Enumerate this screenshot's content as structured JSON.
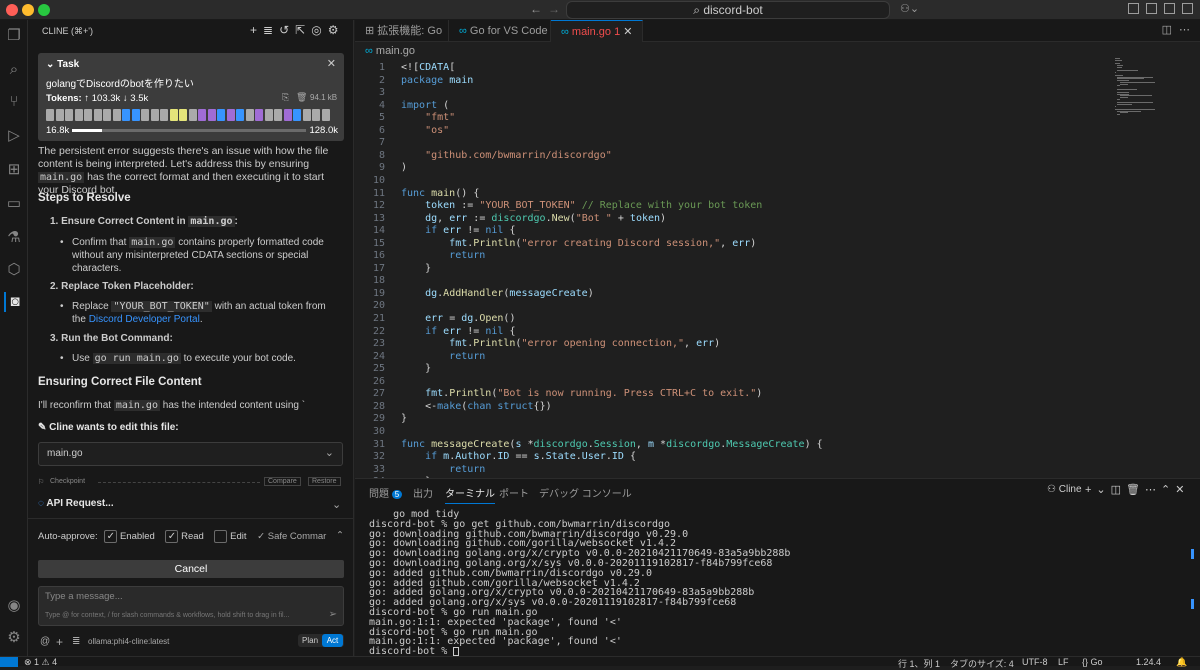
{
  "titlebar": {
    "search": "discord-bot"
  },
  "sidebar": {
    "header": "CLINE (⌘+')",
    "task": {
      "label": "Task",
      "text": "golangでDiscordのbotを作りたい",
      "tokens_label": "Tokens:",
      "tokens_up": "↑ 103.3k",
      "tokens_down": "↓ 3.5k",
      "size": "94.1 kB",
      "ctx_used": "16.8k",
      "ctx_max": "128.0k",
      "ctx_fraction": 0.13
    },
    "intro": "The persistent error suggests there's an issue with how the file content is being interpreted. Let's address this by ensuring",
    "intro_code": "main.go",
    "intro2": "has the correct format and then executing it to start your Discord bot.",
    "steps_heading": "Steps to Resolve",
    "step1_title": "1. Ensure Correct Content in",
    "step1_code": "main.go",
    "step1_colon": ":",
    "step1_a": "Confirm that",
    "step1_b": "main.go",
    "step1_c": "contains properly formatted code without any misinterpreted CDATA sections or special characters.",
    "step2_title": "2. Replace Token Placeholder:",
    "step2_a": "Replace",
    "step2_b": "\"YOUR_BOT_TOKEN\"",
    "step2_c": "with an actual token from the",
    "step2_link": "Discord Developer Portal",
    "step3_title": "3. Run the Bot Command:",
    "step3_a": "Use",
    "step3_b": "go run main.go",
    "step3_c": "to execute your bot code.",
    "ensuring_heading": "Ensuring Correct File Content",
    "reconfirm_a": "I'll reconfirm that",
    "reconfirm_b": "main.go",
    "reconfirm_c": "has the intended content using `",
    "edit_label": "Cline wants to edit this file:",
    "file": "main.go",
    "checkpoint": "Checkpoint",
    "compare": "Compare",
    "restore": "Restore",
    "api": "API Request...",
    "auto_approve": "Auto-approve:",
    "enabled": "Enabled",
    "read": "Read",
    "edit": "Edit",
    "safe": "Safe Commar",
    "cancel": "Cancel",
    "msg_placeholder": "Type a message...",
    "msg_hint": "Type @ for context, / for slash commands & workflows, hold shift to drag in fil...",
    "model": "ollama:phi4-cline:latest",
    "plan": "Plan",
    "act": "Act"
  },
  "editor": {
    "tabs": [
      {
        "label": "拡張機能: Go"
      },
      {
        "label": "Go for VS Code"
      },
      {
        "label": "main.go",
        "badge": "1"
      }
    ],
    "breadcrumb": "main.go"
  },
  "panel": {
    "tabs": [
      "問題",
      "出力",
      "ターミナル",
      "ポート",
      "デバッグ コンソール"
    ],
    "problems_count": "5",
    "terminal_name": "Cline"
  },
  "status": {
    "left": "⊗ 1 ⚠ 4",
    "pos": "行 1、列 1",
    "tab": "タブのサイズ: 4",
    "enc": "UTF-8",
    "eol": "LF",
    "lang": "{} Go",
    "ver": "1.24.4"
  },
  "code_lines": [
    "<![CDATA[",
    "package main",
    "",
    "import (",
    "    \"fmt\"",
    "    \"os\"",
    "",
    "    \"github.com/bwmarrin/discordgo\"",
    ")",
    "",
    "func main() {",
    "    token := \"YOUR_BOT_TOKEN\" // Replace with your bot token",
    "    dg, err := discordgo.New(\"Bot \" + token)",
    "    if err != nil {",
    "        fmt.Println(\"error creating Discord session,\", err)",
    "        return",
    "    }",
    "",
    "    dg.AddHandler(messageCreate)",
    "",
    "    err = dg.Open()",
    "    if err != nil {",
    "        fmt.Println(\"error opening connection,\", err)",
    "        return",
    "    }",
    "",
    "    fmt.Println(\"Bot is now running. Press CTRL+C to exit.\")",
    "    <-make(chan struct{})",
    "}",
    "",
    "func messageCreate(s *discordgo.Session, m *discordgo.MessageCreate) {",
    "    if m.Author.ID == s.State.User.ID {",
    "        return",
    "    }"
  ],
  "terminal_lines": [
    "    go mod tidy",
    "discord-bot % go get github.com/bwmarrin/discordgo",
    "go: downloading github.com/bwmarrin/discordgo v0.29.0",
    "go: downloading github.com/gorilla/websocket v1.4.2",
    "go: downloading golang.org/x/crypto v0.0.0-20210421170649-83a5a9bb288b",
    "go: downloading golang.org/x/sys v0.0.0-20201119102817-f84b799fce68",
    "go: added github.com/bwmarrin/discordgo v0.29.0",
    "go: added github.com/gorilla/websocket v1.4.2",
    "go: added golang.org/x/crypto v0.0.0-20210421170649-83a5a9bb288b",
    "go: added golang.org/x/sys v0.0.0-20201119102817-f84b799fce68",
    "discord-bot % go run main.go",
    "main.go:1:1: expected 'package', found '<'",
    "discord-bot % go run main.go",
    "main.go:1:1: expected 'package', found '<'",
    "discord-bot % "
  ],
  "colors": {
    "accent": "#0078d4",
    "error": "#f14c4c",
    "link": "#3794ff"
  }
}
